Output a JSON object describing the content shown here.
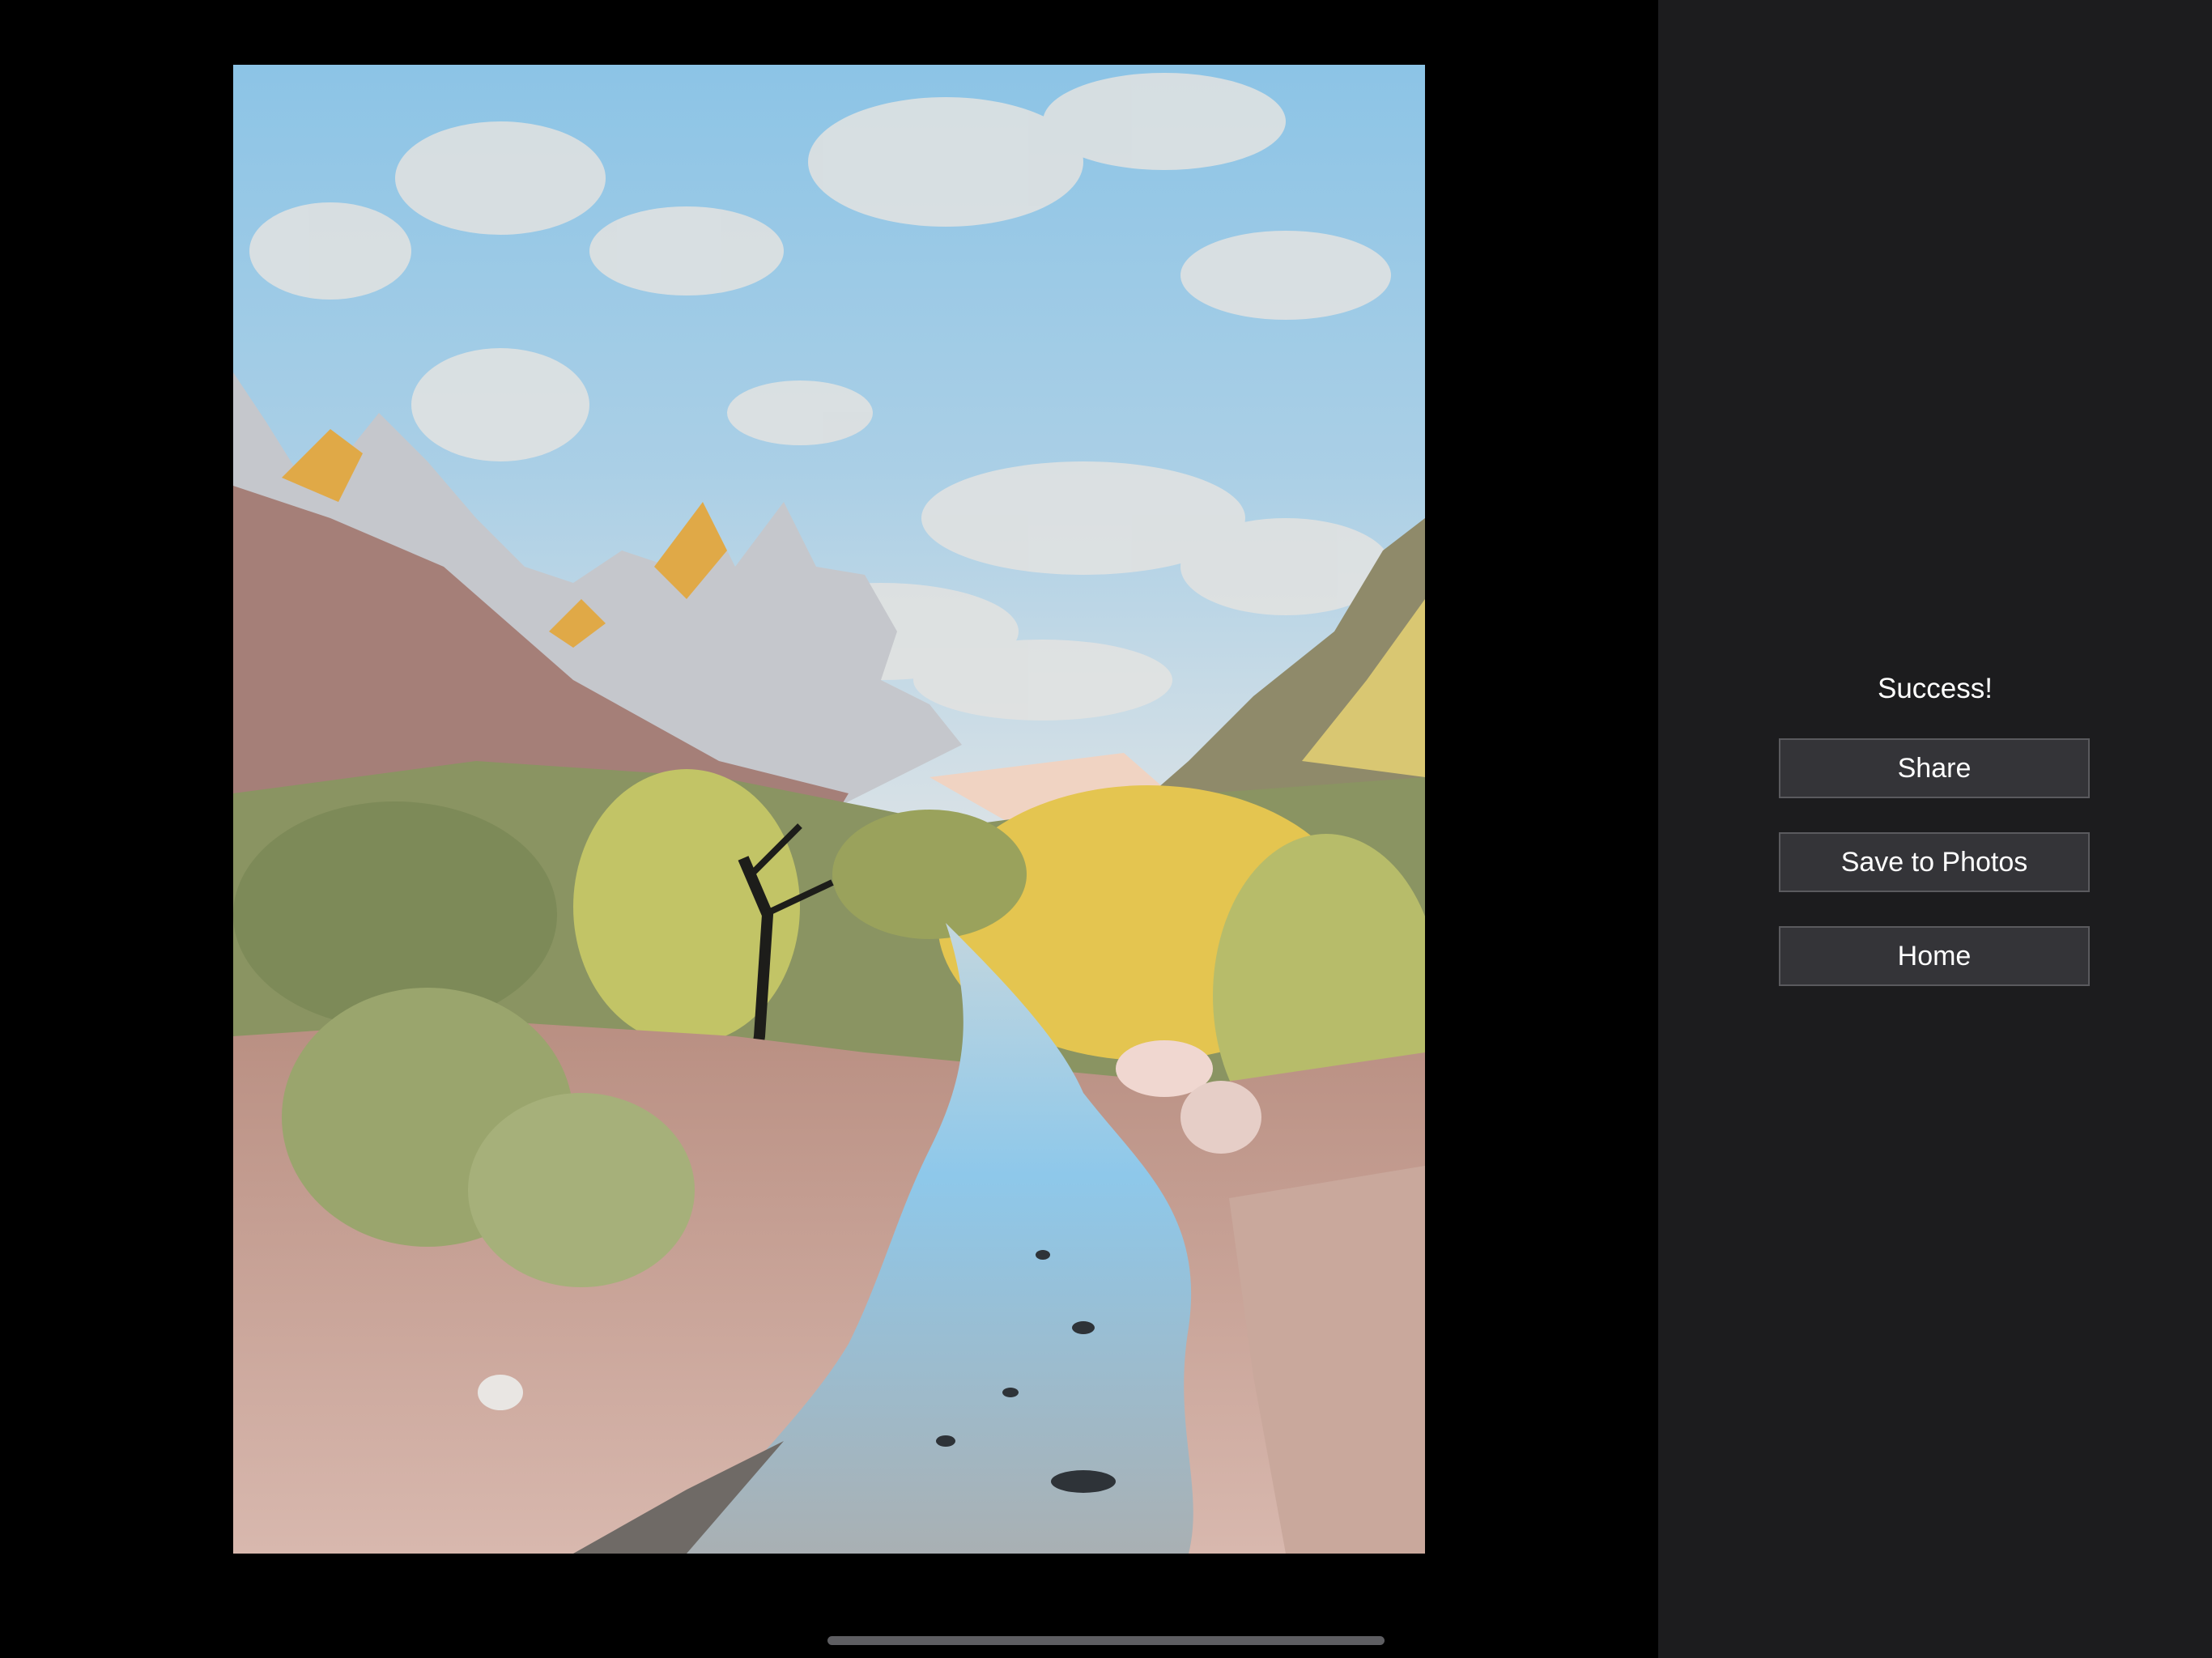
{
  "result_panel": {
    "status_text": "Success!",
    "buttons": {
      "share_label": "Share",
      "save_label": "Save to Photos",
      "home_label": "Home"
    }
  },
  "artwork": {
    "subject": "stylized painting of a mountain canyon with a river"
  },
  "colors": {
    "canvas_background": "#000000",
    "panel_background": "#1c1c1e",
    "button_background": "#343438",
    "button_border": "#5a5a5e",
    "text": "#ffffff",
    "home_indicator": "#5e5e62"
  }
}
